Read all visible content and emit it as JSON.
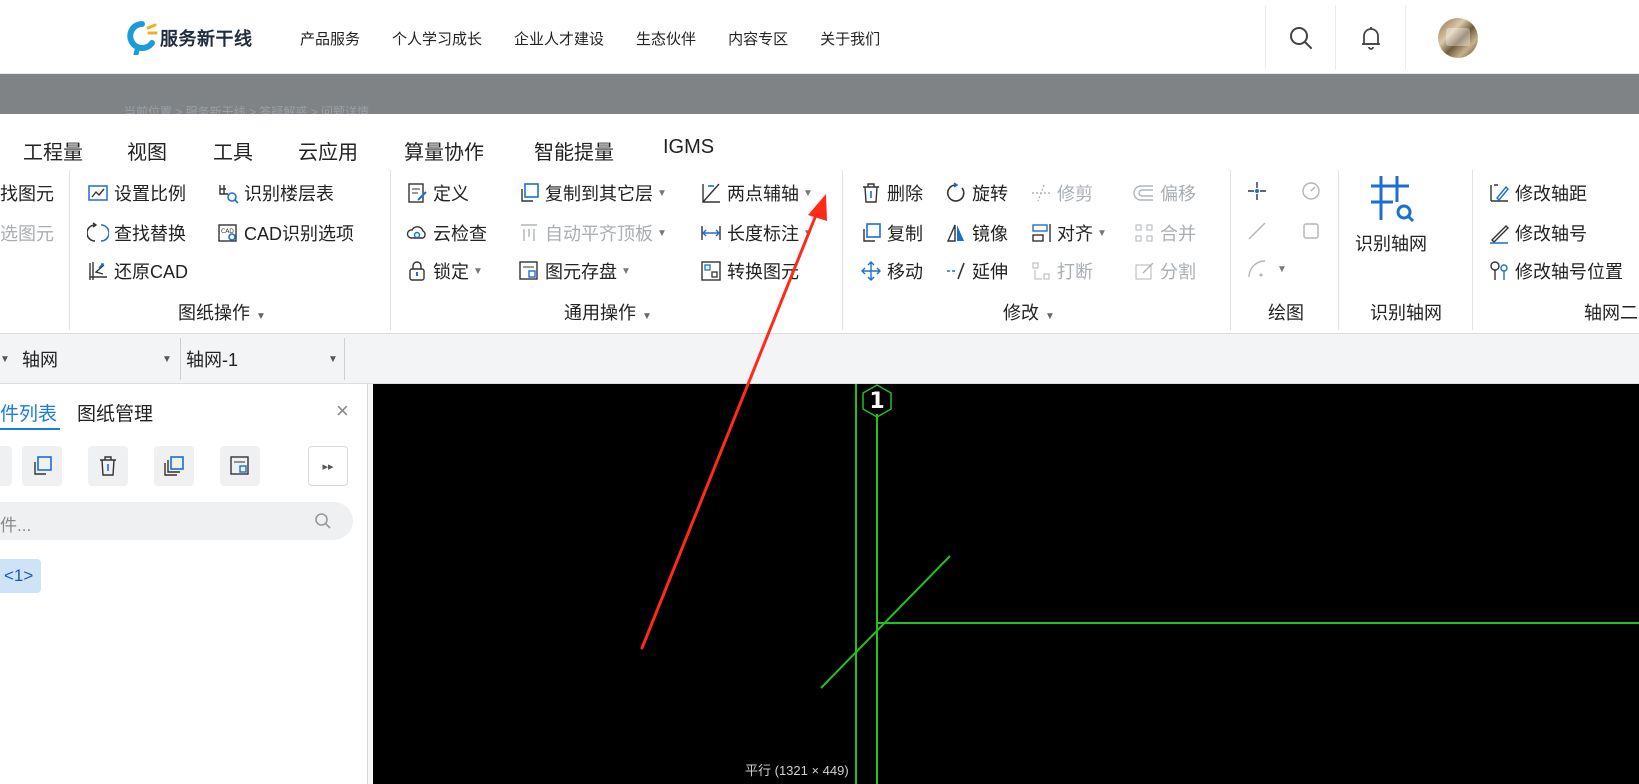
{
  "header": {
    "logo_text": "服务新干线",
    "nav": [
      "产品服务",
      "个人学习成长",
      "企业人才建设",
      "生态伙伴",
      "内容专区",
      "关于我们"
    ]
  },
  "ribbon": {
    "tabs": [
      "工程量",
      "视图",
      "工具",
      "云应用",
      "算量协作",
      "智能提量",
      "IGMS"
    ],
    "groups": {
      "left_partial": {
        "items": [
          "找图元",
          "选图元"
        ]
      },
      "drawing_ops": {
        "label": "图纸操作",
        "items": [
          "设置比例",
          "识别楼层表",
          "查找替换",
          "CAD识别选项",
          "还原CAD"
        ]
      },
      "general_ops": {
        "label": "通用操作",
        "items": [
          "定义",
          "复制到其它层",
          "两点辅轴",
          "云检查",
          "自动平齐顶板",
          "长度标注",
          "锁定",
          "图元存盘",
          "转换图元"
        ]
      },
      "modify": {
        "label": "修改",
        "items": [
          "删除",
          "旋转",
          "修剪",
          "偏移",
          "复制",
          "镜像",
          "对齐",
          "合并",
          "移动",
          "延伸",
          "打断",
          "分割"
        ]
      },
      "draw": {
        "label": "绘图"
      },
      "recognize_axis": {
        "label": "识别轴网",
        "button": "识别轴网"
      },
      "axis_secondary": {
        "label": "轴网二",
        "items": [
          "修改轴距",
          "修改轴号",
          "修改轴号位置"
        ]
      }
    }
  },
  "selectors": {
    "category": "轴网",
    "element": "轴网-1"
  },
  "left_panel": {
    "tabs": [
      "件列表",
      "图纸管理"
    ],
    "search_placeholder": "件...",
    "tag": "<1>"
  },
  "canvas": {
    "axis_number": "1",
    "status": "平行 (1321 × 449)",
    "colors": {
      "background": "#000000",
      "axis_line": "#22c022",
      "annotation_arrow": "#ff2a1a"
    }
  }
}
